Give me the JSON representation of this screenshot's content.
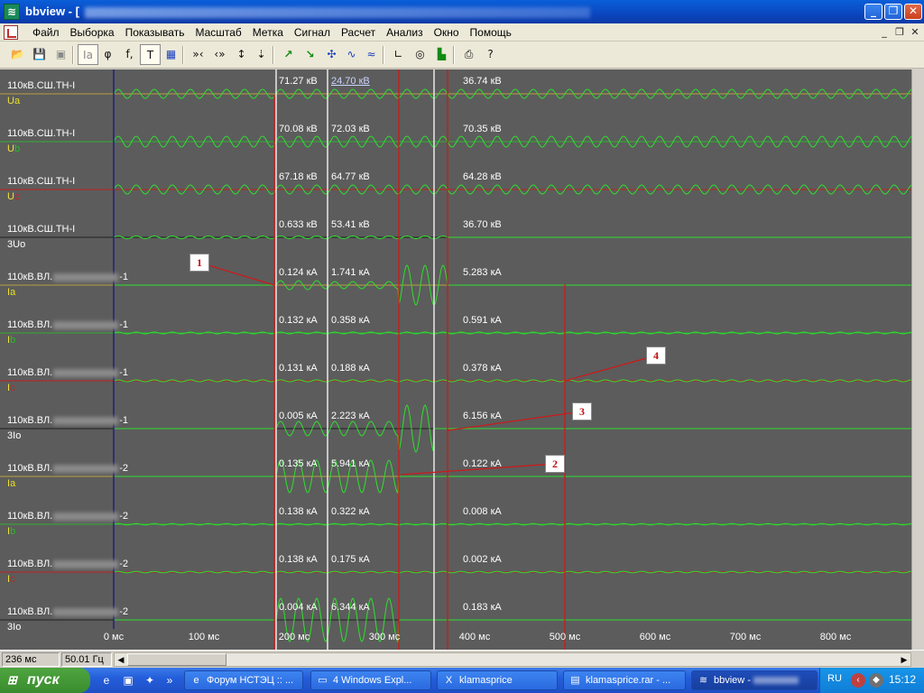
{
  "window": {
    "title": "bbview - [",
    "app_icon": "waveform-app-icon",
    "minimize": "_",
    "maximize": "❐",
    "close": "✕"
  },
  "menu": {
    "items": [
      "Файл",
      "Выборка",
      "Показывать",
      "Масштаб",
      "Метка",
      "Сигнал",
      "Расчет",
      "Анализ",
      "Окно",
      "Помощь"
    ],
    "mdi_minimize": "_",
    "mdi_restore": "❐",
    "mdi_close": "✕"
  },
  "toolbar": {
    "buttons": [
      {
        "icon": "open-folder-icon",
        "glyph": "📂"
      },
      {
        "icon": "save-icon",
        "glyph": "💾"
      },
      {
        "icon": "save-disabled-icon",
        "glyph": "▣"
      },
      {
        "icon": "marker-a-icon",
        "glyph": "Ia"
      },
      {
        "icon": "phase-icon",
        "glyph": "φ"
      },
      {
        "icon": "measure-icon",
        "glyph": "f,"
      },
      {
        "icon": "text-cursor-icon",
        "glyph": "T"
      },
      {
        "icon": "grid-icon",
        "glyph": "▦"
      },
      {
        "icon": "zoom-x-in-icon",
        "glyph": "»‹"
      },
      {
        "icon": "zoom-x-out-icon",
        "glyph": "‹»"
      },
      {
        "icon": "zoom-y-in-icon",
        "glyph": "↕"
      },
      {
        "icon": "zoom-y-out-icon",
        "glyph": "⇣"
      },
      {
        "icon": "signal-rise-icon",
        "glyph": "↗"
      },
      {
        "icon": "signal-fall-icon",
        "glyph": "↘"
      },
      {
        "icon": "signal-cross-icon",
        "glyph": "✣"
      },
      {
        "icon": "signal-wave-icon",
        "glyph": "∿"
      },
      {
        "icon": "signal-mixed-icon",
        "glyph": "≈"
      },
      {
        "icon": "axes-icon",
        "glyph": "∟"
      },
      {
        "icon": "vector-diagram-icon",
        "glyph": "◎"
      },
      {
        "icon": "harmonics-icon",
        "glyph": "▙"
      },
      {
        "icon": "print-icon",
        "glyph": "⎙"
      },
      {
        "icon": "help-context-icon",
        "glyph": "?"
      }
    ]
  },
  "channels": [
    {
      "name": "110кВ.СШ.ТН-I",
      "signal_main": "U",
      "signal_sub": "a",
      "sub_color": "#e8e020",
      "values": [
        "71.27 кВ",
        "24.70 кВ",
        "36.74 кВ"
      ],
      "line_color": "#b8a040"
    },
    {
      "name": "110кВ.СШ.ТН-I",
      "signal_main": "U",
      "signal_sub": "b",
      "sub_color": "#20c020",
      "values": [
        "70.08 кВ",
        "72.03 кВ",
        "70.35 кВ"
      ],
      "line_color": "#30b030"
    },
    {
      "name": "110кВ.СШ.ТН-I",
      "signal_main": "U",
      "signal_sub": "c",
      "sub_color": "#d02020",
      "values": [
        "67.18 кВ",
        "64.77 кВ",
        "64.28 кВ"
      ],
      "line_color": "#c02020"
    },
    {
      "name": "110кВ.СШ.ТН-I",
      "signal_main": "3U",
      "signal_sub": "o",
      "sub_color": "#ffffff",
      "values": [
        "0.633 кВ",
        "53.41 кВ",
        "36.70 кВ"
      ],
      "line_color": "#202020"
    },
    {
      "name_prefix": "110кВ.ВЛ.",
      "name_suffix": "-1",
      "signal_main": "I",
      "signal_sub": "a",
      "sub_color": "#e8e020",
      "values": [
        "0.124 кА",
        "1.741 кА",
        "5.283 кА"
      ],
      "line_color": "#b8a040"
    },
    {
      "name_prefix": "110кВ.ВЛ.",
      "name_suffix": "-1",
      "signal_main": "I",
      "signal_sub": "b",
      "sub_color": "#20c020",
      "values": [
        "0.132 кА",
        "0.358 кА",
        "0.591 кА"
      ],
      "line_color": "#30b030"
    },
    {
      "name_prefix": "110кВ.ВЛ.",
      "name_suffix": "-1",
      "signal_main": "I",
      "signal_sub": "c",
      "sub_color": "#d02020",
      "values": [
        "0.131 кА",
        "0.188 кА",
        "0.378 кА"
      ],
      "line_color": "#c02020"
    },
    {
      "name_prefix": "110кВ.ВЛ.",
      "name_suffix": "-1",
      "signal_main": "3I",
      "signal_sub": "o",
      "sub_color": "#ffffff",
      "values": [
        "0.005 кА",
        "2.223 кА",
        "6.156 кА"
      ],
      "line_color": "#202020"
    },
    {
      "name_prefix": "110кВ.ВЛ.",
      "name_suffix": "-2",
      "signal_main": "I",
      "signal_sub": "a",
      "sub_color": "#e8e020",
      "values": [
        "0.135 кА",
        "5.941 кА",
        "0.122 кА"
      ],
      "line_color": "#b8a040"
    },
    {
      "name_prefix": "110кВ.ВЛ.",
      "name_suffix": "-2",
      "signal_main": "I",
      "signal_sub": "b",
      "sub_color": "#20c020",
      "values": [
        "0.138 кА",
        "0.322 кА",
        "0.008 кА"
      ],
      "line_color": "#30b030"
    },
    {
      "name_prefix": "110кВ.ВЛ.",
      "name_suffix": "-2",
      "signal_main": "I",
      "signal_sub": "c",
      "sub_color": "#d02020",
      "values": [
        "0.138 кА",
        "0.175 кА",
        "0.002 кА"
      ],
      "line_color": "#c02020"
    },
    {
      "name_prefix": "110кВ.ВЛ.",
      "name_suffix": "-2",
      "signal_main": "3I",
      "signal_sub": "o",
      "sub_color": "#ffffff",
      "values": [
        "0.004 кА",
        "6.344 кА",
        "0.183 кА"
      ],
      "line_color": "#202020"
    }
  ],
  "time_axis": {
    "ticks": [
      "0 мс",
      "100 мс",
      "200 мс",
      "300 мс",
      "400 мс",
      "500 мс",
      "600 мс",
      "700 мс",
      "800 мс"
    ],
    "tick_values_ms": [
      0,
      100,
      200,
      300,
      400,
      500,
      600,
      700,
      800
    ]
  },
  "markers": {
    "zero_ms": 0,
    "white_cursors_ms": [
      180,
      237,
      355
    ],
    "red_cursors_ms": [
      178,
      316,
      370,
      500
    ]
  },
  "callouts": [
    "1",
    "2",
    "3",
    "4"
  ],
  "status": {
    "time": "236 мс",
    "frequency": "50.01 Гц"
  },
  "taskbar": {
    "start": "пуск",
    "tasks": [
      {
        "label": "Форум НСТЭЦ :: ...",
        "icon": "ie-icon",
        "glyph": "e"
      },
      {
        "label": "4 Windows Expl...",
        "icon": "folder-icon",
        "glyph": "▭"
      },
      {
        "label": "klamasprice",
        "icon": "excel-icon",
        "glyph": "X"
      },
      {
        "label": "klamasprice.rar - ...",
        "icon": "winrar-icon",
        "glyph": "▤"
      },
      {
        "label": "bbview - ",
        "icon": "bbview-icon",
        "glyph": "≋",
        "active": true
      }
    ],
    "lang": "RU",
    "clock": "15:12"
  },
  "colors": {
    "plot_bg": "#5c5c5c",
    "wave": "#2ee02e",
    "cursor_white": "#e8e8e8",
    "cursor_red": "#d01818",
    "zero_line": "#202080"
  }
}
